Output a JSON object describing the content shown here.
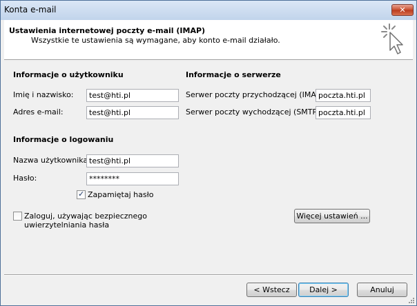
{
  "window": {
    "title": "Konta e-mail",
    "close_label": "✕"
  },
  "header": {
    "title": "Ustawienia internetowej poczty e-mail (IMAP)",
    "subtitle": "Wszystkie te ustawienia są wymagane, aby konto e-mail działało."
  },
  "user_info": {
    "heading": "Informacje o użytkowniku",
    "name_label": "Imię i nazwisko:",
    "name_value": "test@hti.pl",
    "email_label": "Adres e-mail:",
    "email_value": "test@hti.pl"
  },
  "server_info": {
    "heading": "Informacje o serwerze",
    "incoming_label": "Serwer poczty przychodzącej (IMAP):",
    "incoming_value": "poczta.hti.pl",
    "outgoing_label": "Serwer poczty wychodzącej (SMTP):",
    "outgoing_value": "poczta.hti.pl"
  },
  "login_info": {
    "heading": "Informacje o logowaniu",
    "username_label": "Nazwa użytkownika:",
    "username_value": "test@hti.pl",
    "password_label": "Hasło:",
    "password_value": "********",
    "remember_label": "Zapamiętaj hasło",
    "remember_checked": true
  },
  "spa": {
    "label_line1": "Zaloguj, używając bezpiecznego",
    "label_line2": "uwierzytelniania hasła",
    "checked": false
  },
  "buttons": {
    "more_settings": "Więcej ustawień ...",
    "back": "< Wstecz",
    "next": "Dalej >",
    "cancel": "Anuluj"
  }
}
